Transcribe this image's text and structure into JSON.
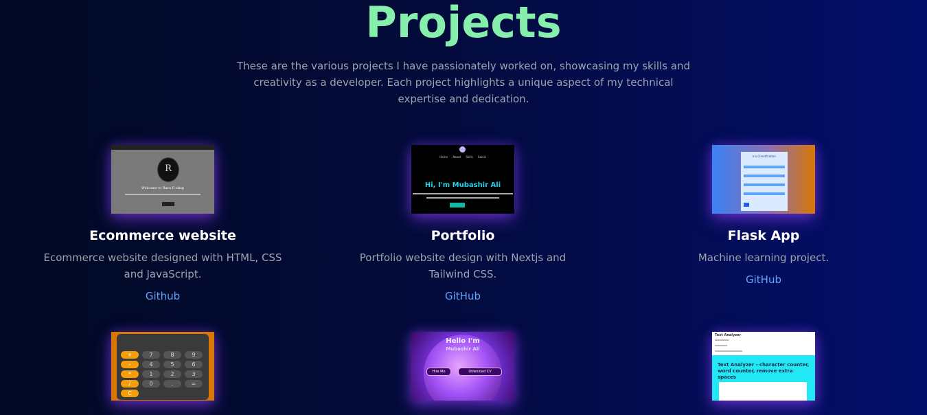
{
  "section": {
    "title": "Projects",
    "intro": "These are the various projects I have passionately worked on, showcasing my skills and creativity as a developer. Each project highlights a unique aspect of my technical expertise and dedication."
  },
  "projects": [
    {
      "title": "Ecommerce website",
      "description": "Ecommerce website designed with HTML, CSS and JavaScript.",
      "link": "Github"
    },
    {
      "title": "Portfolio",
      "description": "Portfolio website design with Nextjs and Tailwind CSS.",
      "link": "GitHub"
    },
    {
      "title": "Flask App",
      "description": "Machine learning project.",
      "link": "GitHub"
    }
  ],
  "thumbnails": {
    "portfolio_greeting": "Hi, I'm Mubashir Ali",
    "calculator_keys": [
      "+",
      "7",
      "8",
      "9",
      "-",
      "4",
      "5",
      "6",
      "*",
      "1",
      "2",
      "3",
      "/",
      "0",
      ".",
      "=",
      "C"
    ],
    "globe_greeting": "Hello I'm",
    "globe_name": "Mubashir Ali",
    "globe_hire": "Hire Me",
    "globe_download": "Download CV",
    "analyzer_heading": "Text Analyzer - character counter, word counter, remove extra spaces"
  },
  "colors": {
    "title": "#86efac",
    "link": "#60a5fa",
    "muted": "#9ca3af"
  }
}
